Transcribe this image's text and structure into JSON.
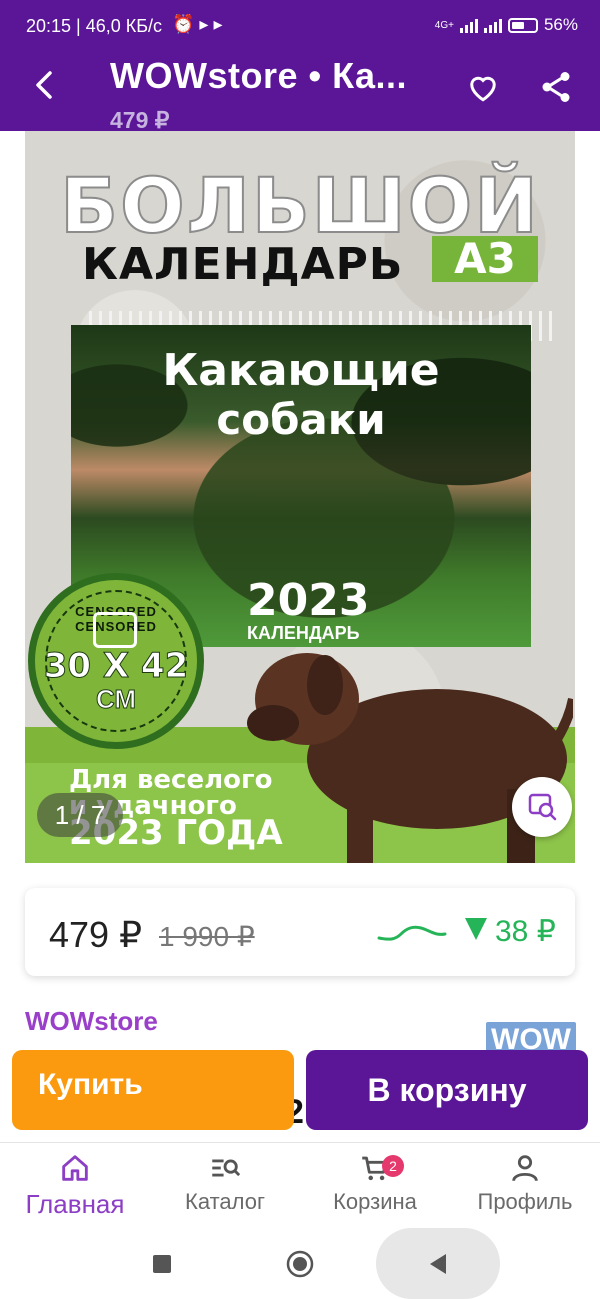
{
  "status": {
    "time": "20:15 | 46,0 КБ/с",
    "extra_icons": "⏰ ▸ ▸",
    "network": "4G+",
    "battery": "56%"
  },
  "appbar": {
    "title": "WOWstore • Ка...",
    "price": "479 ₽"
  },
  "gallery": {
    "headline": "БОЛЬШОЙ",
    "subhead": "КАЛЕНДАРЬ",
    "format": "А3",
    "calendar_title_1": "Какающие",
    "calendar_title_2": "собаки",
    "calendar_year": "2023",
    "calendar_label": "КАЛЕНДАРЬ",
    "badge_censored": "CENSORED CENSORED",
    "badge_size": "30 X 42",
    "badge_unit": "СМ",
    "promo_1": "Для веселого",
    "promo_2": "и удачного",
    "promo_3": "2023 ГОДА",
    "counter": "1 / 7"
  },
  "price_card": {
    "price": "479 ₽",
    "old_price": "1 990 ₽",
    "delta": "38 ₽",
    "trend": "down",
    "trend_color": "#26b458"
  },
  "seller": {
    "name": "WOWstore",
    "logo": "WOW",
    "partial_text": "2"
  },
  "actions": {
    "buy_label": "Купить",
    "cart_label": "В корзину"
  },
  "tabs": [
    {
      "label": "Главная",
      "icon": "home-icon",
      "active": true
    },
    {
      "label": "Каталог",
      "icon": "catalog-search-icon",
      "active": false
    },
    {
      "label": "Корзина",
      "icon": "cart-icon",
      "active": false,
      "badge": "2"
    },
    {
      "label": "Профиль",
      "icon": "profile-icon",
      "active": false
    }
  ],
  "colors": {
    "brand": "#5b1597",
    "buy": "#fb9a0e",
    "accent_text": "#9a3fc9"
  }
}
